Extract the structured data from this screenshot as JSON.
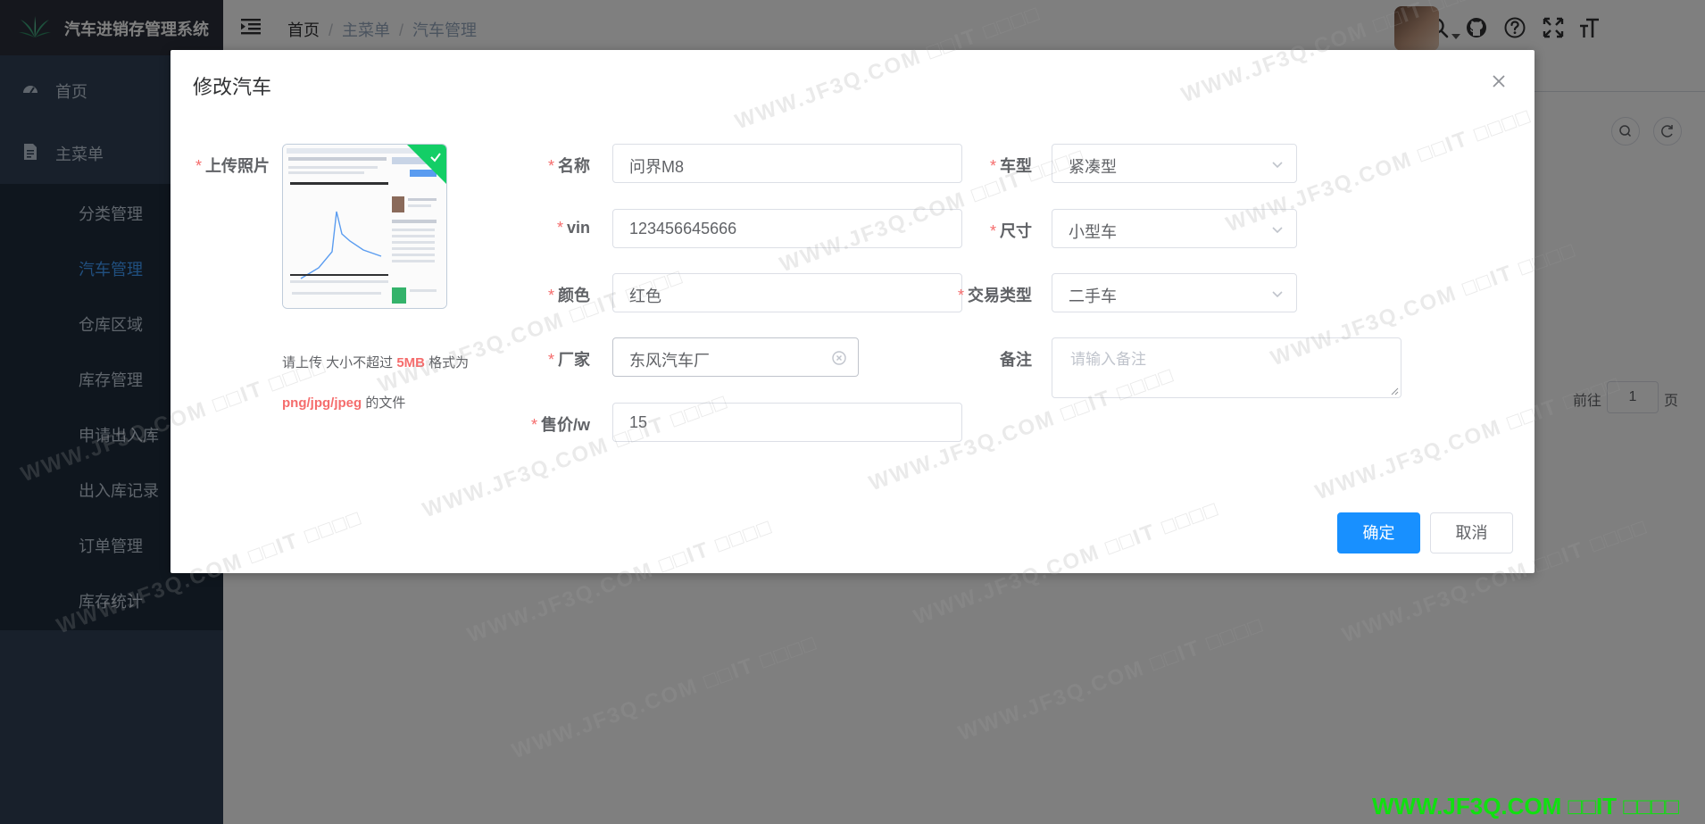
{
  "app": {
    "title": "汽车进销存管理系统"
  },
  "sidebar": {
    "items": [
      {
        "label": "首页",
        "icon": "dashboard-icon"
      },
      {
        "label": "主菜单",
        "icon": "document-icon"
      }
    ],
    "submenu": [
      {
        "label": "分类管理"
      },
      {
        "label": "汽车管理",
        "active": true
      },
      {
        "label": "仓库区域"
      },
      {
        "label": "库存管理"
      },
      {
        "label": "申请出入库"
      },
      {
        "label": "出入库记录"
      },
      {
        "label": "订单管理"
      },
      {
        "label": "库存统计"
      }
    ]
  },
  "navbar": {
    "breadcrumb": [
      "首页",
      "主菜单",
      "汽车管理"
    ],
    "icons": [
      "search-icon",
      "github-icon",
      "help-icon",
      "fullscreen-icon",
      "font-size-icon"
    ]
  },
  "pagination": {
    "goto_label": "前往",
    "page": "1",
    "page_suffix": "页"
  },
  "dialog": {
    "title": "修改汽车",
    "upload": {
      "label": "上传照片",
      "tip_prefix": "请上传 大小不超过 ",
      "tip_size": "5MB",
      "tip_mid": " 格式为 ",
      "tip_format": "png/jpg/jpeg",
      "tip_suffix": " 的文件"
    },
    "fields": {
      "name": {
        "label": "名称",
        "value": "问界M8"
      },
      "vin": {
        "label": "vin",
        "value": "123456645666"
      },
      "color": {
        "label": "颜色",
        "value": "红色"
      },
      "manufacturer": {
        "label": "厂家",
        "value": "东风汽车厂"
      },
      "price": {
        "label": "售价/w",
        "value": "15"
      },
      "car_type": {
        "label": "车型",
        "value": "紧凑型"
      },
      "size": {
        "label": "尺寸",
        "value": "小型车"
      },
      "trade_type": {
        "label": "交易类型",
        "value": "二手车"
      },
      "remark": {
        "label": "备注",
        "placeholder": "请输入备注"
      }
    },
    "buttons": {
      "confirm": "确定",
      "cancel": "取消"
    }
  },
  "watermark": {
    "text": "WWW.JF3Q.COM □□IT □□□□"
  },
  "colors": {
    "primary": "#1890ff",
    "sidebar_bg": "#304156",
    "required": "#f56c6c",
    "success": "#13ce66"
  }
}
